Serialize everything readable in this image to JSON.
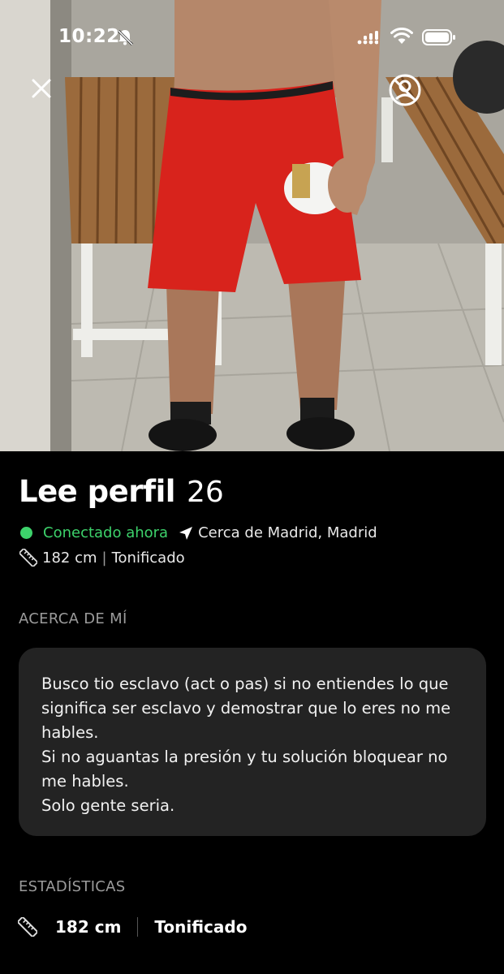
{
  "status_bar": {
    "time": "10:22",
    "icons": [
      "bell-slash-icon",
      "signal-icon",
      "wifi-icon",
      "battery-icon"
    ]
  },
  "photo": {
    "close_icon": "close-icon",
    "profile_icon": "profile-circle-icon"
  },
  "profile": {
    "name": "Lee perfil",
    "age": "26",
    "online_status": "Conectado ahora",
    "location": "Cerca de Madrid, Madrid",
    "height": "182 cm",
    "separator": "|",
    "body_type": "Tonificado"
  },
  "about": {
    "title": "ACERCA DE MÍ",
    "lines": [
      "Busco tio esclavo (act o pas) si no entiendes lo que",
      "significa ser esclavo y demostrar que lo eres no me",
      "hables.",
      "Si no aguantas la presión y tu solución bloquear no",
      "me hables.",
      "Solo gente seria."
    ]
  },
  "stats": {
    "title": "ESTADÍSTICAS",
    "height": "182 cm",
    "body_type": "Tonificado"
  },
  "colors": {
    "background": "#000000",
    "online_green": "#3dd26b",
    "card_bg": "#232323",
    "section_title": "#9b9b9b",
    "shorts_red": "#d8231c"
  }
}
